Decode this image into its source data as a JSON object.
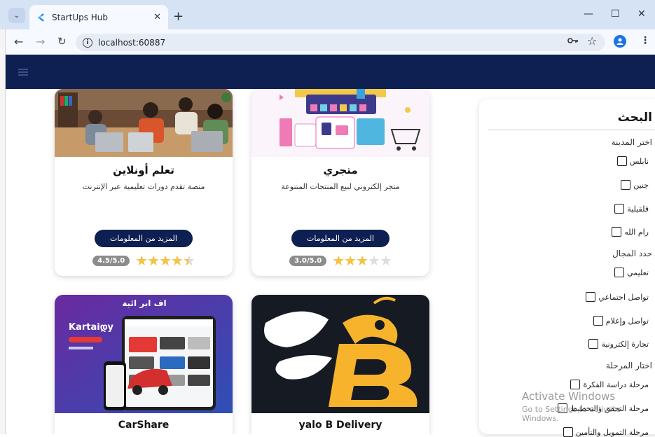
{
  "browser": {
    "tab_title": "StartUps Hub",
    "url": "localhost:60887",
    "colors": {
      "tabstrip": "#d6e3f5",
      "toolbar": "#f6f9ff"
    }
  },
  "app": {
    "header_color": "#0e1f52",
    "accent": "#0e1f52",
    "star_color": "#f5c242"
  },
  "cards": [
    {
      "name": "تعلم أونلاين",
      "description": "منصة تقدم دورات تعليمية عبر الإنترنت",
      "button": "المزيد من المعلومات",
      "rating_text": "4.5/5.0",
      "rating": 4.5
    },
    {
      "name": "متجري",
      "description": "متجر إلكتروني لبيع المنتجات المتنوعة",
      "button": "المزيد من المعلومات",
      "rating_text": "3.0/5.0",
      "rating": 3.0
    },
    {
      "name": "CarShare",
      "image_text": {
        "heading": "اف ابر ائية",
        "brand": "Kartaiდy"
      }
    },
    {
      "name": "yalo B Delivery"
    }
  ],
  "sidebar": {
    "title": "البحث",
    "city_heading": "اختر المدينة",
    "cities": [
      "نابلس",
      "جنين",
      "قلقيلية",
      "رام الله"
    ],
    "field_heading": "حدد المجال",
    "fields": [
      "تعليمي",
      "تواصل اجتماعي",
      "تواصل وإعلام",
      "تجارة إلكترونية"
    ],
    "stage_heading": "اختار المرحلة",
    "stages": [
      "مرحلة دراسة الفكرة",
      "مرحلة التحقق والتخطيط",
      "مرحلة التمويل والتأمين"
    ]
  },
  "watermark": {
    "line1": "Activate Windows",
    "line2": "Go to Settings to activate Windows."
  }
}
